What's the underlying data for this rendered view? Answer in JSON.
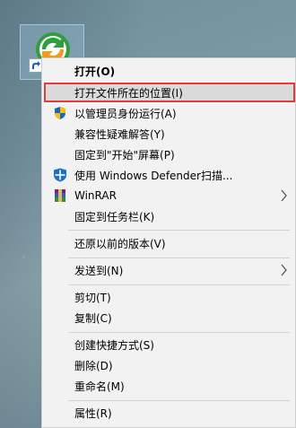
{
  "menu": {
    "items": [
      {
        "id": "open",
        "label": "打开(O)",
        "bold": true
      },
      {
        "id": "open-location",
        "label": "打开文件所在的位置(I)",
        "highlighted": true
      },
      {
        "id": "run-as-admin",
        "label": "以管理员身份运行(A)",
        "icon": "uac-shield-icon"
      },
      {
        "id": "compat",
        "label": "兼容性疑难解答(Y)"
      },
      {
        "id": "pin-start",
        "label": "固定到\"开始\"屏幕(P)"
      },
      {
        "id": "defender",
        "label": "使用 Windows Defender扫描...",
        "icon": "windows-defender-icon"
      },
      {
        "id": "winrar",
        "label": "WinRAR",
        "icon": "winrar-icon",
        "submenu": true
      },
      {
        "id": "pin-taskbar",
        "label": "固定到任务栏(K)"
      },
      {
        "id": "restore",
        "label": "还原以前的版本(V)"
      },
      {
        "id": "send-to",
        "label": "发送到(N)",
        "submenu": true
      },
      {
        "id": "cut",
        "label": "剪切(T)"
      },
      {
        "id": "copy",
        "label": "复制(C)"
      },
      {
        "id": "create-shortcut",
        "label": "创建快捷方式(S)"
      },
      {
        "id": "delete",
        "label": "删除(D)"
      },
      {
        "id": "rename",
        "label": "重命名(M)"
      },
      {
        "id": "properties",
        "label": "属性(R)"
      }
    ]
  },
  "colors": {
    "menu_bg": "#f2f2f2",
    "highlight_bg": "#dadada",
    "highlight_border": "#e23b3b"
  }
}
